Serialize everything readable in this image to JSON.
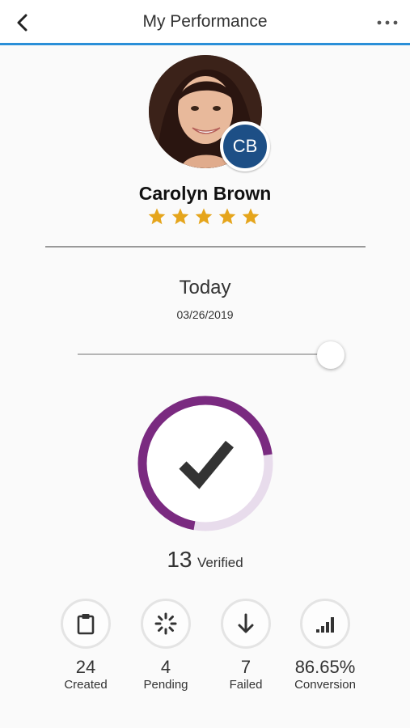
{
  "header": {
    "title": "My Performance",
    "back_icon": "chevron-left-icon",
    "more_icon": "more-horizontal-icon",
    "accent_color": "#2a8fd8"
  },
  "profile": {
    "initials": "CB",
    "name": "Carolyn Brown",
    "rating": 5,
    "rating_max": 5,
    "star_color": "#e5a51c",
    "badge_color": "#1d4f86"
  },
  "period": {
    "label": "Today",
    "date": "03/26/2019",
    "slider_value": 1.0
  },
  "verification": {
    "count": "13",
    "label": "Verified",
    "progress": 0.7,
    "ring_color": "#7a2a80",
    "ring_track_color": "#e8dcec",
    "icon": "checkmark-icon"
  },
  "stats": [
    {
      "value": "24",
      "label": "Created",
      "icon": "clipboard-icon"
    },
    {
      "value": "4",
      "label": "Pending",
      "icon": "spinner-icon"
    },
    {
      "value": "7",
      "label": "Failed",
      "icon": "arrow-down-icon"
    },
    {
      "value": "86.65%",
      "label": "Conversion",
      "icon": "signal-bars-icon"
    }
  ]
}
